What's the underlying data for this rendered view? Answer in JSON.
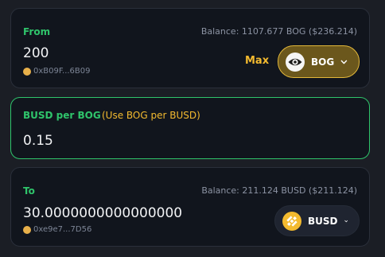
{
  "from": {
    "label": "From",
    "balance": "Balance: 1107.677 BOG ($236.214)",
    "amount": "200",
    "address": "0xB09F...6B09",
    "max_label": "Max",
    "token": {
      "symbol": "BOG",
      "icon": "bog-eye-logo-icon",
      "color": "#e2b73a"
    }
  },
  "rate": {
    "label": "BUSD per BOG",
    "toggle_hint": "(Use BOG per BUSD)",
    "value": "0.15"
  },
  "to": {
    "label": "To",
    "balance": "Balance: 211.124 BUSD ($211.124)",
    "amount": "30.0000000000000000",
    "address": "0xe9e7...7D56",
    "token": {
      "symbol": "BUSD",
      "icon": "busd-logo-icon",
      "color": "#f3ba2f"
    }
  },
  "colors": {
    "accent_green": "#2fc46b",
    "accent_yellow": "#f3ba2f",
    "background": "#1b1e25",
    "card": "#11151d"
  }
}
